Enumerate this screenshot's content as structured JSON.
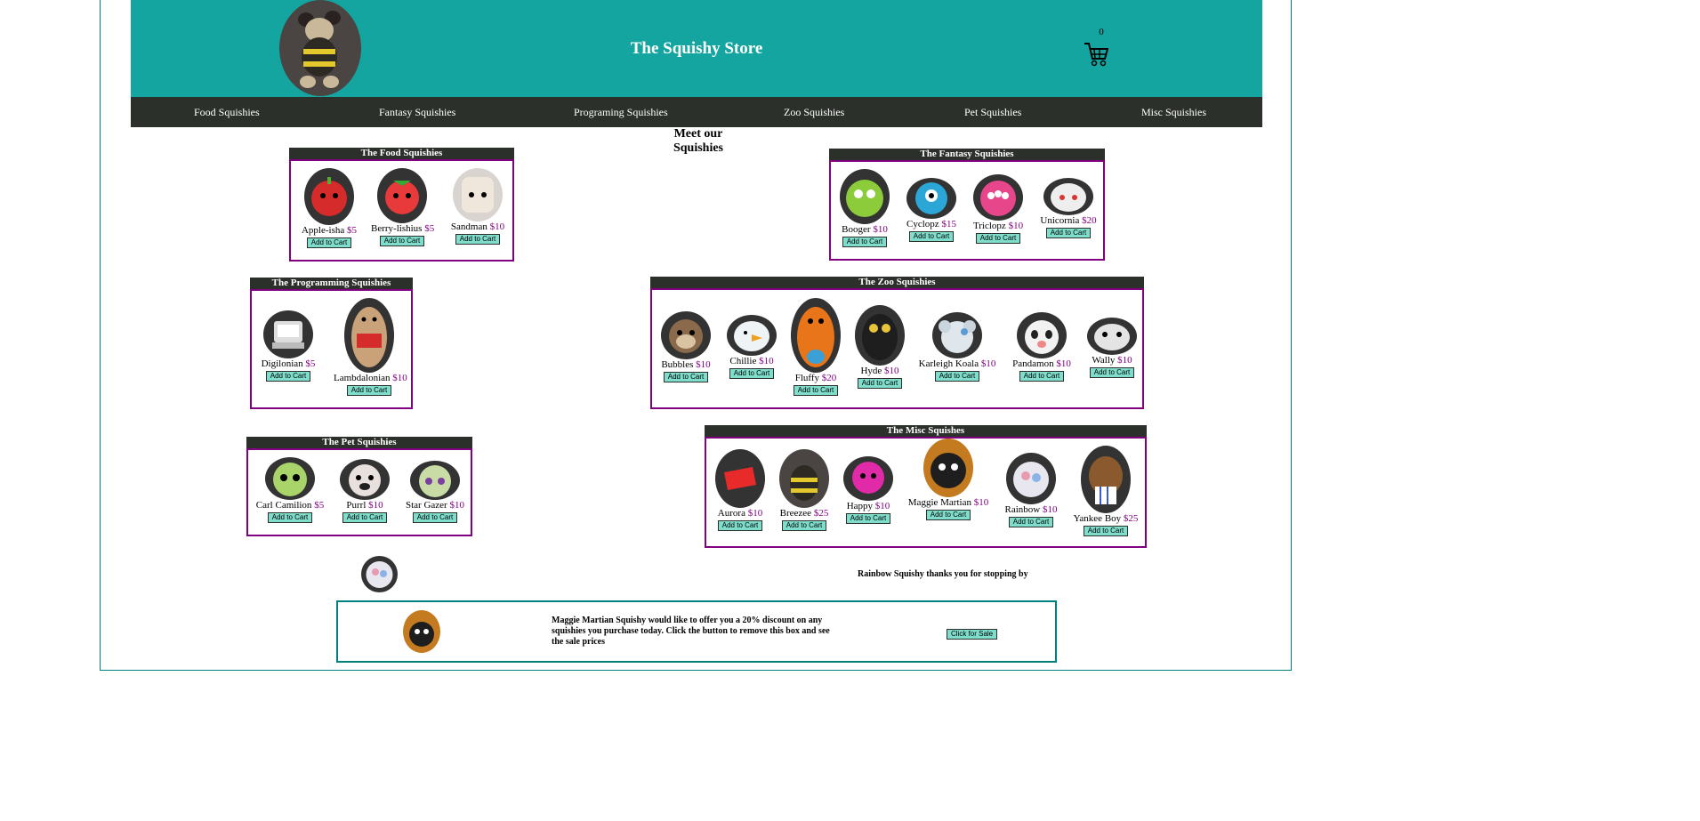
{
  "store": {
    "title": "The Squishy Store",
    "cart_count": "0"
  },
  "nav": [
    "Food Squishies",
    "Fantasy Squishies",
    "Programing Squishies",
    "Zoo Squishies",
    "Pet Squishies",
    "Misc Squishies"
  ],
  "meet_heading": "Meet our Squishies",
  "add_label": "Add to Cart",
  "sections": {
    "food": {
      "title": "The Food Squishies",
      "items": [
        {
          "name": "Apple-isha",
          "price": "$5"
        },
        {
          "name": "Berry-lishius",
          "price": "$5"
        },
        {
          "name": "Sandman",
          "price": "$10"
        }
      ]
    },
    "fantasy": {
      "title": "The Fantasy Squishies",
      "items": [
        {
          "name": "Booger",
          "price": "$10"
        },
        {
          "name": "Cyclopz",
          "price": "$15"
        },
        {
          "name": "Triclopz",
          "price": "$10"
        },
        {
          "name": "Unicornia",
          "price": "$20"
        }
      ]
    },
    "programming": {
      "title": "The Programming Squishies",
      "items": [
        {
          "name": "Digilonian",
          "price": "$5"
        },
        {
          "name": "Lambdalonian",
          "price": "$10"
        }
      ]
    },
    "zoo": {
      "title": "The Zoo Squishies",
      "items": [
        {
          "name": "Bubbles",
          "price": "$10"
        },
        {
          "name": "Chillie",
          "price": "$10"
        },
        {
          "name": "Fluffy",
          "price": "$20"
        },
        {
          "name": "Hyde",
          "price": "$10"
        },
        {
          "name": "Karleigh Koala",
          "price": "$10"
        },
        {
          "name": "Pandamon",
          "price": "$10"
        },
        {
          "name": "Wally",
          "price": "$10"
        }
      ]
    },
    "pet": {
      "title": "The Pet Squishies",
      "items": [
        {
          "name": "Carl Camilion",
          "price": "$5"
        },
        {
          "name": "Purrl",
          "price": "$10"
        },
        {
          "name": "Star Gazer",
          "price": "$10"
        }
      ]
    },
    "misc": {
      "title": "The Misc Squishes",
      "items": [
        {
          "name": "Aurora",
          "price": "$10"
        },
        {
          "name": "Breezee",
          "price": "$25"
        },
        {
          "name": "Happy",
          "price": "$10"
        },
        {
          "name": "Maggie Martian",
          "price": "$10"
        },
        {
          "name": "Rainbow",
          "price": "$10"
        },
        {
          "name": "Yankee Boy",
          "price": "$25"
        }
      ]
    }
  },
  "footer": {
    "thanks": "Rainbow Squishy thanks you for stopping by",
    "sale_text": "Maggie Martian Squishy would like to offer you a 20% discount on any squishies you purchase today. Click the button to remove this box and see the sale prices",
    "sale_button": "Click for Sale"
  },
  "colors": {
    "header": "#14a5a0",
    "nav": "#2c302b",
    "border": "#800080",
    "button": "#7fdecb",
    "frame": "#008080"
  }
}
